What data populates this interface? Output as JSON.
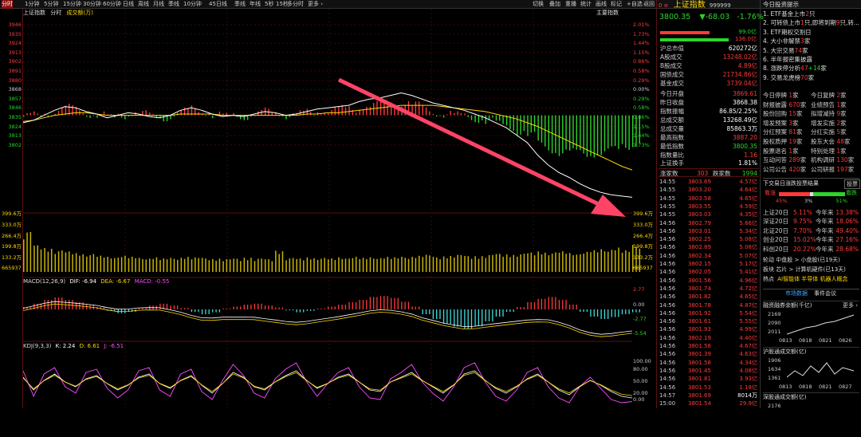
{
  "toolbar": {
    "left": [
      "分时",
      "1分钟",
      "5分钟",
      "15分钟",
      "30分钟",
      "60分钟",
      "日线",
      "周线",
      "月线",
      "季线",
      "10分钟",
      "45日线",
      "季线",
      "年线",
      "5秒",
      "15秒",
      "多分时",
      "更多 ›"
    ],
    "right": [
      "切换",
      "叠加",
      "重播",
      "统计",
      "画线",
      "标记",
      "+自选",
      "返回"
    ]
  },
  "chart_header": {
    "name": "上证指数",
    "mode": "分时",
    "vol_label": "成交额(万)",
    "main_index_button": "主要指数"
  },
  "price_axis": {
    "left": [
      "3946",
      "3935",
      "3924",
      "3913",
      "3902",
      "3891",
      "3880",
      "3868",
      "3857",
      "3846",
      "3835",
      "3824",
      "3813",
      "3802"
    ],
    "right": [
      "2.01%",
      "1.73%",
      "1.44%",
      "1.15%",
      "0.86%",
      "0.58%",
      "0.29%",
      "0.00%",
      "0.29%",
      "0.58%",
      "0.86%",
      "1.15%",
      "1.44%",
      "1.73%"
    ]
  },
  "volume_axis": {
    "left": [
      "399.6万",
      "333.0万",
      "266.4万",
      "199.8万",
      "133.2万",
      "665937"
    ],
    "right": [
      "399.6万",
      "333.0万",
      "266.4万",
      "199.8万",
      "133.2万",
      "665937"
    ]
  },
  "macd": {
    "label": "MACD(12,26,9)",
    "dif": "DIF: -6.94",
    "dea": "DEA: -6.67",
    "macd": "MACD: -0.55",
    "axis": [
      "2.77",
      "0.00",
      "-2.77",
      "-5.54"
    ]
  },
  "kdj": {
    "label": "KDJ(9,3,3)",
    "k": "K: 2.24",
    "d": "D: 6.61",
    "j": "J: -6.51",
    "axis": [
      "100.00",
      "80.00",
      "50.00",
      "20.00",
      "0.00"
    ]
  },
  "colors": {
    "up": "#ff3a3a",
    "down": "#2bd52b",
    "price_line": "#ffffff",
    "avg_line": "#ffd800",
    "arrow": "#ff4466"
  },
  "chart_data": {
    "type": "line",
    "x_domain": [
      "09:30",
      "15:00"
    ],
    "ylim": [
      3792,
      3946
    ],
    "prev_close": 3868,
    "price": [
      3862,
      3864,
      3868,
      3872,
      3875,
      3874,
      3871,
      3869,
      3866,
      3868,
      3870,
      3869,
      3867,
      3866,
      3868,
      3872,
      3874,
      3872,
      3869,
      3867,
      3868,
      3867,
      3869,
      3871,
      3870,
      3868,
      3869,
      3871,
      3873,
      3874,
      3875,
      3876,
      3879,
      3881,
      3882,
      3884,
      3886,
      3884,
      3881,
      3878,
      3876,
      3874,
      3872,
      3869,
      3866,
      3862,
      3858,
      3852,
      3846,
      3836,
      3828,
      3822,
      3818,
      3813,
      3809,
      3806,
      3804,
      3803,
      3802
    ],
    "avg": [
      3863,
      3864,
      3866,
      3868,
      3869,
      3870,
      3870,
      3869,
      3868,
      3868,
      3868,
      3868,
      3868,
      3868,
      3868,
      3869,
      3869,
      3869,
      3869,
      3868,
      3868,
      3868,
      3868,
      3868,
      3868,
      3868,
      3868,
      3869,
      3869,
      3870,
      3870,
      3871,
      3872,
      3873,
      3874,
      3875,
      3876,
      3876,
      3876,
      3876,
      3875,
      3874,
      3873,
      3872,
      3871,
      3869,
      3867,
      3865,
      3862,
      3859,
      3855,
      3851,
      3847,
      3843,
      3839,
      3835,
      3831,
      3827,
      3824
    ],
    "volume_ratio": [
      0.75,
      0.5,
      0.45,
      0.4,
      0.38,
      0.35,
      0.33,
      0.3,
      0.28,
      0.3,
      0.28,
      0.26,
      0.27,
      0.25,
      0.26,
      0.28,
      0.27,
      0.26,
      0.25,
      0.24,
      0.25,
      0.27,
      0.25,
      0.24,
      0.4,
      0.26,
      0.25,
      0.27,
      0.26,
      0.25,
      0.27,
      0.28,
      0.26,
      0.27,
      0.28,
      0.27,
      0.28,
      0.3,
      0.32,
      0.28,
      0.3,
      0.32,
      0.3,
      0.3,
      0.32,
      0.34,
      0.33,
      0.34,
      0.36,
      0.38,
      0.36,
      0.38,
      0.35,
      0.37,
      0.4,
      0.42,
      0.45,
      0.4,
      0.5
    ],
    "macd_hist": [
      0.5,
      1.2,
      2,
      2.5,
      2,
      1.5,
      1,
      0.5,
      -0.3,
      -0.8,
      -0.5,
      0.3,
      0.8,
      1.2,
      0.8,
      0.3,
      -0.5,
      -1,
      -0.6,
      0.2,
      0.6,
      1,
      1.2,
      0.8,
      0.4,
      -0.2,
      -0.6,
      -0.3,
      0.2,
      0.6,
      1,
      1.5,
      2,
      2.6,
      2.8,
      2.4,
      1.6,
      0.6,
      -1,
      -2,
      -3,
      -3.6,
      -4,
      -3.5,
      -2.5,
      -1.5,
      -0.5,
      0.5,
      1.5,
      2.2,
      2.6,
      2,
      1,
      -0.5,
      -1.5,
      -2,
      -1.6,
      -1,
      -0.6
    ],
    "kdj_k": [
      70,
      30,
      60,
      80,
      55,
      40,
      65,
      75,
      50,
      30,
      45,
      70,
      80,
      50,
      35,
      60,
      75,
      45,
      20,
      50,
      85,
      70,
      40,
      30,
      55,
      75,
      90,
      60,
      35,
      50,
      70,
      80,
      55,
      30,
      25,
      55,
      70,
      85,
      60,
      40,
      20,
      45,
      80,
      90,
      60,
      35,
      20,
      40,
      65,
      80,
      55,
      30,
      15,
      40,
      60,
      45,
      25,
      10,
      5
    ],
    "kdj_j": [
      90,
      10,
      80,
      100,
      40,
      20,
      85,
      95,
      35,
      5,
      30,
      90,
      100,
      30,
      10,
      80,
      95,
      25,
      0,
      60,
      110,
      75,
      20,
      5,
      65,
      95,
      115,
      55,
      10,
      50,
      85,
      100,
      40,
      5,
      0,
      65,
      85,
      110,
      55,
      20,
      -5,
      40,
      100,
      115,
      55,
      10,
      -5,
      30,
      85,
      100,
      40,
      5,
      -10,
      40,
      70,
      35,
      0,
      -10,
      -6.5
    ]
  },
  "right_panel": {
    "index_head": {
      "code_hint": "0 ≡",
      "name": "上证指数",
      "code": "999999"
    },
    "price": "3800.35",
    "change": "▼-68.03",
    "pct": "-1.76%",
    "ratio_up": "99.0亿",
    "ratio_down": "136.0亿",
    "stats": [
      [
        "沪总市值",
        "620272亿",
        "wht"
      ],
      [
        "A股成交",
        "13248.02亿",
        "red"
      ],
      [
        "B股成交",
        "4.89亿",
        "red"
      ],
      [
        "国债成交",
        "21734.86亿",
        "red"
      ],
      [
        "基金成交",
        "3739.04亿",
        "red"
      ],
      [
        "今日开盘",
        "3869.61",
        "red"
      ],
      [
        "昨日收盘",
        "3868.38",
        "wht"
      ],
      [
        "指数振幅",
        "86.85/2.25%",
        "wht"
      ],
      [
        "总成交额",
        "13268.49亿",
        "wht"
      ],
      [
        "总成交量",
        "85863.3万",
        "wht"
      ],
      [
        "最高指数",
        "3887.20",
        "red"
      ],
      [
        "最低指数",
        "3800.35",
        "green"
      ],
      [
        "指数量比",
        "1.16",
        "red"
      ],
      [
        "上证换手",
        "1.81%",
        "wht"
      ]
    ],
    "updown": {
      "label_up": "涨家数",
      "up": "303",
      "label_down": "跌家数",
      "down": "1994"
    },
    "ticks": [
      [
        "14:55",
        "3803.69",
        "4.57亿"
      ],
      [
        "14:55",
        "3803.20",
        "4.64亿"
      ],
      [
        "14:55",
        "3803.58",
        "4.65亿"
      ],
      [
        "14:55",
        "3803.55",
        "4.59亿"
      ],
      [
        "14:55",
        "3803.03",
        "4.35亿"
      ],
      [
        "14:56",
        "3802.79",
        "5.66亿"
      ],
      [
        "14:56",
        "3803.01",
        "5.34亿"
      ],
      [
        "14:56",
        "3802.25",
        "5.08亿"
      ],
      [
        "14:56",
        "3802.89",
        "5.08亿"
      ],
      [
        "14:56",
        "3802.34",
        "5.07亿"
      ],
      [
        "14:56",
        "3802.15",
        "5.17亿"
      ],
      [
        "14:56",
        "3802.05",
        "5.41亿"
      ],
      [
        "14:56",
        "3801.56",
        "4.96亿"
      ],
      [
        "14:56",
        "3801.74",
        "4.72亿"
      ],
      [
        "14:56",
        "3801.82",
        "4.65亿"
      ],
      [
        "14:56",
        "3801.78",
        "4.87亿"
      ],
      [
        "14:56",
        "3801.92",
        "5.54亿"
      ],
      [
        "14:56",
        "3801.61",
        "5.55亿"
      ],
      [
        "14:56",
        "3801.93",
        "4.99亿"
      ],
      [
        "14:56",
        "3802.19",
        "4.40亿"
      ],
      [
        "14:56",
        "3801.58",
        "4.67亿"
      ],
      [
        "14:56",
        "3801.39",
        "4.63亿"
      ],
      [
        "14:56",
        "3801.58",
        "4.34亿"
      ],
      [
        "14:56",
        "3801.45",
        "4.08亿"
      ],
      [
        "14:56",
        "3801.81",
        "3.93亿"
      ],
      [
        "14:56",
        "3801.53",
        "1.18亿"
      ],
      [
        "14:57",
        "3801.69",
        "8014万"
      ],
      [
        "15:00",
        "3801.54",
        "29.9亿"
      ]
    ]
  },
  "info_panel": {
    "title": "今日投资提示",
    "tips": [
      {
        "n": "1.",
        "pre": "ETF基金上市",
        "num": "2",
        "post": "只"
      },
      {
        "n": "2.",
        "pre": "可转债上市",
        "num": "1",
        "post": "只,即将到期",
        "num2": "9",
        "post2": "只,转..."
      },
      {
        "n": "3.",
        "pre": "ETF期权交割日",
        "num": "",
        "post": ""
      },
      {
        "n": "4.",
        "pre": "大小非解禁",
        "num": "3",
        "post": "家"
      },
      {
        "n": "5.",
        "pre": "大宗交易",
        "num": "74",
        "post": "家"
      },
      {
        "n": "6.",
        "pre": "半年报密集披露",
        "num": "",
        "post": ""
      },
      {
        "n": "8.",
        "pre": "涨跌停分析",
        "num": "47",
        "post": "",
        "num2": "+14",
        "post2": "家"
      },
      {
        "n": "9.",
        "pre": "交易龙虎榜",
        "num": "70",
        "post": "家"
      }
    ],
    "grid": [
      [
        "今日停牌",
        "1",
        "家",
        "今日复牌",
        "2",
        "家"
      ],
      [
        "财报披露",
        "670",
        "家",
        "业绩预告",
        "1",
        "家"
      ],
      [
        "股份回购",
        "15",
        "家",
        "拟增减持",
        "9",
        "家"
      ],
      [
        "增发预案",
        "3",
        "家",
        "增发实施",
        "2",
        "家"
      ],
      [
        "分红预案",
        "81",
        "家",
        "分红实施",
        "5",
        "家"
      ],
      [
        "股权质押",
        "19",
        "家",
        "股东大会",
        "48",
        "家"
      ],
      [
        "股票退名",
        "1",
        "家",
        "特别处理",
        "1",
        "家"
      ],
      [
        "互动问答",
        "289",
        "家",
        "机构调研",
        "130",
        "家"
      ],
      [
        "公司公告",
        "420",
        "家",
        "公司研报",
        "197",
        "家"
      ]
    ],
    "next_title": "下交易日涨跌投票结果",
    "vote_button": "投票",
    "vote": {
      "bull": "看涨",
      "bear": "看跌",
      "p_bull": "45%",
      "p_mid": "3%",
      "p_bear": "51%"
    },
    "perf": [
      [
        "上证20日",
        "5.11%",
        "今年来",
        "13.38%"
      ],
      [
        "深证20日",
        "9.75%",
        "今年来",
        "18.06%"
      ],
      [
        "北证20日",
        "7.70%",
        "今年来",
        "49.40%"
      ],
      [
        "创业20日",
        "15.02%",
        "今年来",
        "27.16%"
      ],
      [
        "科创20日",
        "20.22%",
        "今年来",
        "28.68%"
      ]
    ],
    "rotation": {
      "a": "轮动 中盘股 > 小盘股(已19天)",
      "b": "板块 芯片 > 计算机硬件(已13天)",
      "c_label": "热点",
      "c_val": "AI智能体 半导体 机器人概念"
    },
    "tabs": [
      "市场数据",
      "事件会议"
    ],
    "mini": [
      {
        "title": "融资融券余额(千亿)",
        "more": "更多 ›",
        "y": [
          "2169",
          "2090",
          "2011"
        ],
        "x": [
          "0813",
          "0818",
          "0821",
          "0826"
        ]
      },
      {
        "title": "沪股通成交额(亿)",
        "more": "",
        "y": [
          "1906",
          "1634",
          "1361"
        ],
        "x": [
          "0813",
          "0818",
          "0821",
          "0827"
        ]
      },
      {
        "title": "深股通成交额(亿)",
        "more": "",
        "y": [
          "2176"
        ],
        "x": []
      }
    ]
  }
}
